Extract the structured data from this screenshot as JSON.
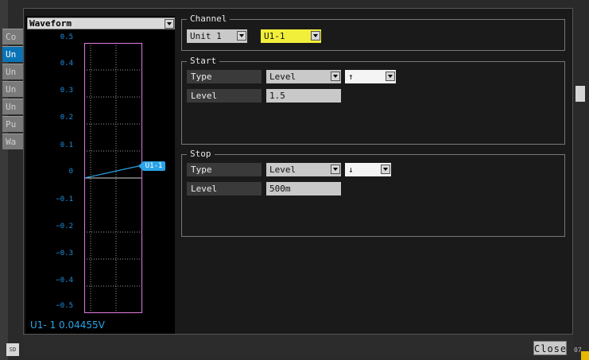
{
  "side_tabs": [
    {
      "label": "Co",
      "active": false
    },
    {
      "label": "Un",
      "active": true
    },
    {
      "label": "Un",
      "active": false
    },
    {
      "label": "Un",
      "active": false
    },
    {
      "label": "Un",
      "active": false
    },
    {
      "label": "Pu",
      "active": false
    },
    {
      "label": "Wa",
      "active": false
    }
  ],
  "sd_icon_label": "SD",
  "waveform": {
    "selector_label": "Waveform",
    "y_ticks": [
      "0.5",
      "0.4",
      "0.3",
      "0.2",
      "0.1",
      "0",
      "−0.1",
      "−0.2",
      "−0.3",
      "−0.4",
      "−0.5"
    ],
    "channel_tag": "U1-1",
    "readout": "U1- 1 0.04455V",
    "trace_color": "#2aa4e8",
    "frame_color": "#e07be0"
  },
  "channel": {
    "title": "Channel",
    "unit_value": "Unit 1",
    "channel_value": "U1-1"
  },
  "start": {
    "title": "Start",
    "type_label": "Type",
    "type_value": "Level",
    "direction_value": "↑",
    "level_label": "Level",
    "level_value": "1.5"
  },
  "stop": {
    "title": "Stop",
    "type_label": "Type",
    "type_value": "Level",
    "direction_value": "↓",
    "level_label": "Level",
    "level_value": "500m"
  },
  "close_label": "Close",
  "corner_text": "07"
}
